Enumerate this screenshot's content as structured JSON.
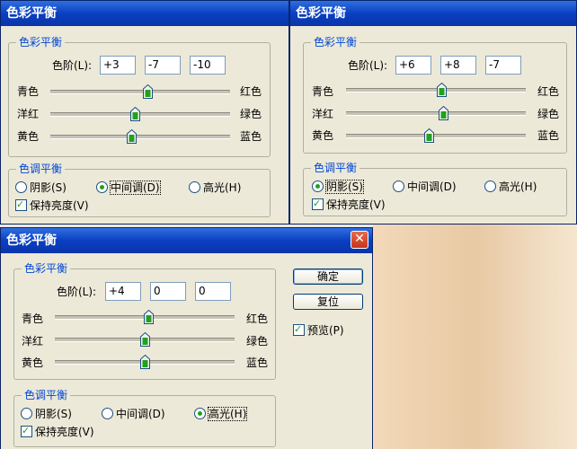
{
  "win1": {
    "title": "色彩平衡",
    "group1": {
      "legend": "色彩平衡",
      "levels_label": "色阶(L):",
      "fields": [
        "+3",
        "-7",
        "-10"
      ]
    },
    "sliders": [
      {
        "left": "青色",
        "right": "红色",
        "value": 0.54
      },
      {
        "left": "洋红",
        "right": "绿色",
        "value": 0.47
      },
      {
        "left": "黄色",
        "right": "蓝色",
        "value": 0.45
      }
    ],
    "group2": {
      "legend": "色调平衡",
      "radios": [
        "阴影(S)",
        "中间调(D)",
        "高光(H)"
      ],
      "selected": 1,
      "preserve_label": "保持亮度(V)",
      "preserve_checked": true
    }
  },
  "win2": {
    "title": "色彩平衡",
    "group1": {
      "legend": "色彩平衡",
      "levels_label": "色阶(L):",
      "fields": [
        "+6",
        "+8",
        "-7"
      ]
    },
    "sliders": [
      {
        "left": "青色",
        "right": "红色",
        "value": 0.53
      },
      {
        "left": "洋红",
        "right": "绿色",
        "value": 0.54
      },
      {
        "left": "黄色",
        "right": "蓝色",
        "value": 0.46
      }
    ],
    "group2": {
      "legend": "色调平衡",
      "radios": [
        "阴影(S)",
        "中间调(D)",
        "高光(H)"
      ],
      "selected": 0,
      "preserve_label": "保持亮度(V)",
      "preserve_checked": true
    }
  },
  "win3": {
    "title": "色彩平衡",
    "group1": {
      "legend": "色彩平衡",
      "levels_label": "色阶(L):",
      "fields": [
        "+4",
        "0",
        "0"
      ]
    },
    "sliders": [
      {
        "left": "青色",
        "right": "红色",
        "value": 0.52
      },
      {
        "left": "洋红",
        "right": "绿色",
        "value": 0.5
      },
      {
        "left": "黄色",
        "right": "蓝色",
        "value": 0.5
      }
    ],
    "group2": {
      "legend": "色调平衡",
      "radios": [
        "阴影(S)",
        "中间调(D)",
        "高光(H)"
      ],
      "selected": 2,
      "preserve_label": "保持亮度(V)",
      "preserve_checked": true
    },
    "buttons": {
      "ok": "确定",
      "reset": "复位"
    },
    "preview_label": "预览(P)",
    "preview_checked": true,
    "close_icon": "close-icon"
  },
  "colors": {
    "title_bar": "#0a3fc3",
    "dialog_bg": "#ece9d8",
    "legend_text": "#0046d5",
    "close_button": "#c8341a"
  }
}
